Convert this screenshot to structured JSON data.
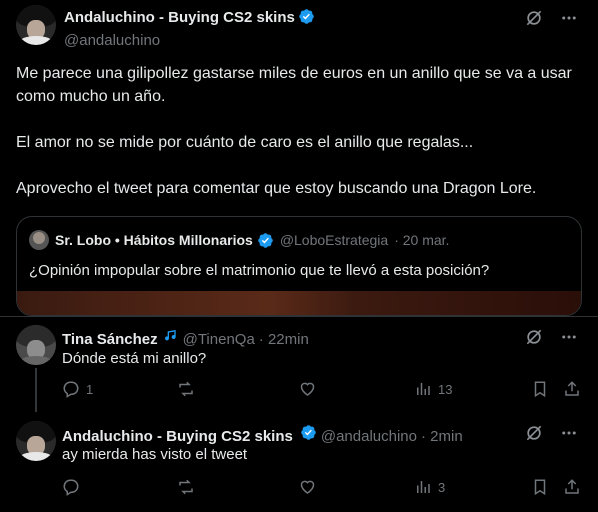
{
  "main_tweet": {
    "author_name": "Andaluchino - Buying CS2 skins",
    "author_handle": "@andaluchino",
    "paragraphs": [
      "Me parece una gilipollez gastarse miles de euros en un anillo que se va a usar como mucho un año.",
      "El amor no se mide por cuánto de caro es el anillo que regalas...",
      "Aprovecho el tweet para comentar que estoy buscando una Dragon Lore."
    ],
    "quote": {
      "author_name": "Sr. Lobo • Hábitos Millonarios",
      "author_handle": "@LoboEstrategia",
      "time": "· 20 mar.",
      "text": "¿Opinión impopular sobre el matrimonio que te llevó a esta posición?"
    }
  },
  "replies": [
    {
      "author_name": "Tina Sánchez",
      "author_handle": "@TinenQa",
      "time": "· 22min",
      "text": "Dónde está mi anillo?",
      "reply_count": "1",
      "retweet_count": "",
      "like_count": "",
      "view_count": "13"
    },
    {
      "author_name": "Andaluchino - Buying CS2 skins",
      "author_handle": "@andaluchino",
      "time": "· 2min",
      "text": "ay mierda has visto el tweet",
      "reply_count": "",
      "retweet_count": "",
      "like_count": "",
      "view_count": "3"
    }
  ],
  "icons": {
    "verified": "verified-badge-icon",
    "grok": "grok-icon",
    "more": "more-icon",
    "reply": "reply-icon",
    "retweet": "retweet-icon",
    "like": "like-icon",
    "views": "views-icon",
    "bookmark": "bookmark-icon",
    "share": "share-icon"
  },
  "colors": {
    "background": "#000000",
    "text": "#e7e9ea",
    "muted": "#71767b",
    "border": "#2f3336",
    "verified": "#1d9bf0"
  }
}
